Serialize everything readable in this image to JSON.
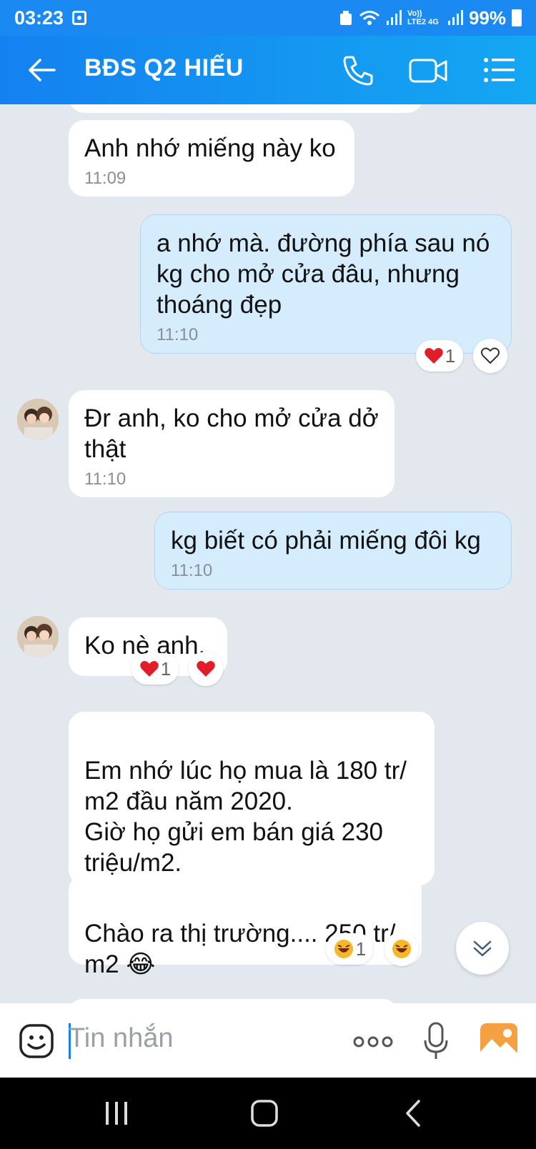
{
  "status_bar": {
    "time": "03:23",
    "battery": "99%",
    "network_label": "Vo)) LTE2 4G"
  },
  "header": {
    "title": "BĐS Q2 HIẾU"
  },
  "messages": [
    {
      "direction": "in",
      "text": "Anh nhớ miếng này ko",
      "time": "11:09"
    },
    {
      "direction": "out",
      "text": "a nhớ mà. đường phía sau nó kg cho mở cửa đâu, nhưng thoáng đẹp",
      "time": "11:10",
      "reaction_count": "1"
    },
    {
      "direction": "in",
      "text": "Đr anh, ko cho mở cửa dở thật",
      "time": "11:10"
    },
    {
      "direction": "out",
      "text": "kg biết có phải miếng đôi kg",
      "time": "11:10"
    },
    {
      "direction": "in",
      "text": "Ko nè anh.",
      "reaction_count": "1"
    },
    {
      "direction": "in",
      "text": "Em nhớ lúc họ mua là 180 tr/\nm2 đầu năm 2020.\nGiờ họ gửi em bán giá 230\ntriệu/m2."
    },
    {
      "direction": "in",
      "text": "Chào ra thị trường.... 250 tr/\nm2 😂",
      "reaction_count": "1"
    }
  ],
  "input": {
    "placeholder": "Tin nhắn"
  },
  "colors": {
    "header_start": "#1481f0",
    "header_end": "#14a7f2",
    "outgoing_bubble": "#d5ecfd",
    "incoming_bubble": "#ffffff",
    "chat_bg": "#e3e8ef"
  }
}
